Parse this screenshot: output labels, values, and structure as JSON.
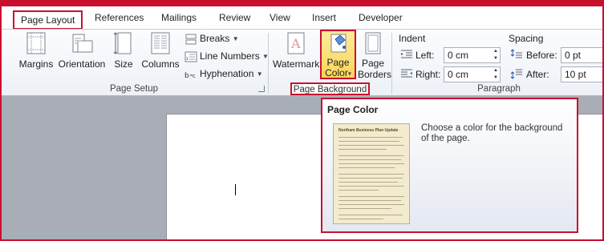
{
  "tabs": [
    {
      "label": "Page Layout",
      "active": true
    },
    {
      "label": "References"
    },
    {
      "label": "Mailings"
    },
    {
      "label": "Review"
    },
    {
      "label": "View"
    },
    {
      "label": "Insert"
    },
    {
      "label": "Developer"
    }
  ],
  "page_setup": {
    "margins": "Margins",
    "orientation": "Orientation",
    "size": "Size",
    "columns": "Columns",
    "breaks": "Breaks",
    "line_numbers": "Line Numbers",
    "hyphenation": "Hyphenation",
    "group_label": "Page Setup"
  },
  "page_background": {
    "watermark": "Watermark",
    "page_color_l1": "Page",
    "page_color_l2": "Color",
    "page_borders_l1": "Page",
    "page_borders_l2": "Borders",
    "group_label": "Page Background"
  },
  "paragraph": {
    "indent_title": "Indent",
    "left_label": "Left:",
    "left_value": "0 cm",
    "right_label": "Right:",
    "right_value": "0 cm",
    "spacing_title": "Spacing",
    "before_label": "Before:",
    "before_value": "0 pt",
    "after_label": "After:",
    "after_value": "10 pt",
    "group_label": "Paragraph"
  },
  "tooltip": {
    "title": "Page Color",
    "description": "Choose a color for the background of the page.",
    "thumbnail_heading": "Northam Business Plan Update"
  },
  "colors": {
    "highlight": "#c8102e",
    "ribbon_bg": "#edf1f7",
    "button_active": "#f9d65a",
    "doc_bg": "#a9aeb6"
  }
}
